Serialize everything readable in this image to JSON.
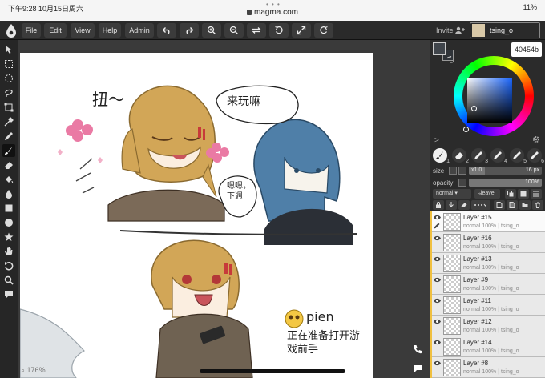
{
  "status_bar": {
    "time_date": "下午9:28  10月15日周六",
    "url": "magma.com",
    "battery": "11%"
  },
  "menu": [
    "File",
    "Edit",
    "View",
    "Help",
    "Admin"
  ],
  "toolbar_icons": [
    "undo-icon",
    "redo-icon",
    "zoom-in-icon",
    "zoom-out-icon",
    "flip-icon",
    "rotate-ccw-icon",
    "fullscreen-icon",
    "rotate-cw-icon"
  ],
  "invite": "Invite",
  "user": {
    "name": "tsing_o"
  },
  "zoom": "176%",
  "color": {
    "hex": "40454b",
    "primary": "#40454b",
    "secondary": "#2f3338"
  },
  "brush_slots": [
    "1",
    "2",
    "3",
    "4",
    "5",
    "6"
  ],
  "size": {
    "label": "size",
    "value": "16 px",
    "sub": "x1.0"
  },
  "opacity": {
    "label": "opacity",
    "value": "100%"
  },
  "blend": {
    "mode": "normal",
    "action": "leave"
  },
  "layers": [
    {
      "name": "Layer #15",
      "meta": "normal 100% | tsing_o",
      "selected": true
    },
    {
      "name": "Layer #16",
      "meta": "normal 100% | tsing_o"
    },
    {
      "name": "Layer #13",
      "meta": "normal 100% | tsing_o"
    },
    {
      "name": "Layer #9",
      "meta": "normal 100% | tsing_o"
    },
    {
      "name": "Layer #11",
      "meta": "normal 100% | tsing_o"
    },
    {
      "name": "Layer #12",
      "meta": "normal 100% | tsing_o"
    },
    {
      "name": "Layer #14",
      "meta": "normal 100% | tsing_o"
    },
    {
      "name": "Layer #8",
      "meta": "normal 100% | tsing_o"
    }
  ],
  "canvas_text": {
    "top_left": "扭～",
    "bubble_top": "来玩嘛",
    "bubble_small": "嗯嗯，下週",
    "pien": "pien",
    "bottom": "正在准备打开游戏前手"
  }
}
